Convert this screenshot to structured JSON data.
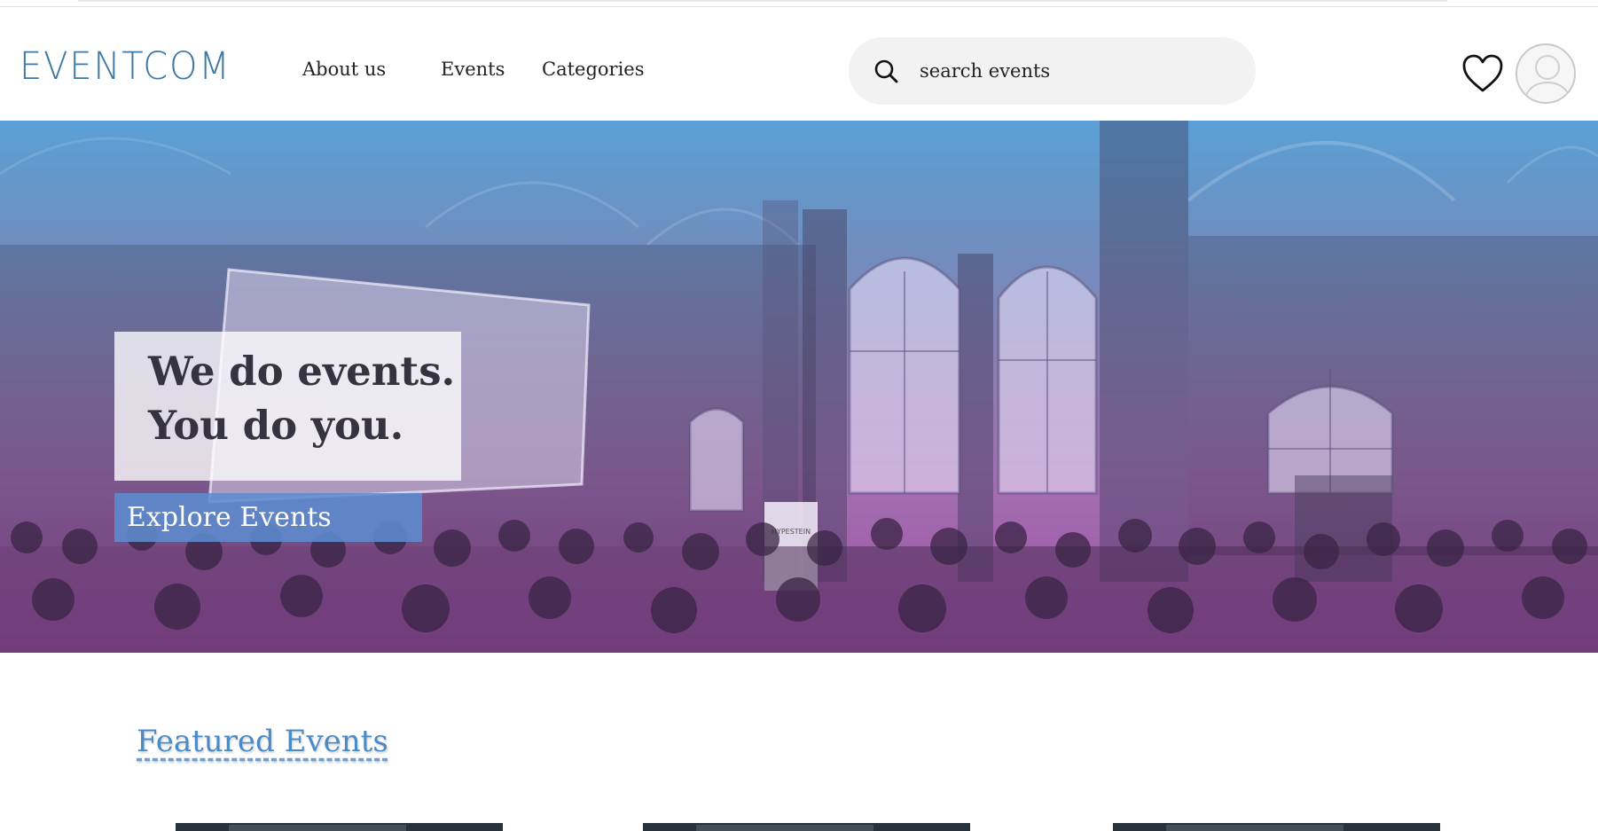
{
  "brand": {
    "logo": "EVENTCOM",
    "color": "#3d79a4"
  },
  "nav": {
    "items": [
      {
        "label": "About us"
      },
      {
        "label": "Events"
      },
      {
        "label": "Categories"
      }
    ]
  },
  "search": {
    "placeholder": "search events",
    "value": "",
    "icon": "search-icon"
  },
  "header_actions": {
    "favorites_icon": "heart-icon",
    "profile_icon": "user-avatar-icon"
  },
  "hero": {
    "headline_line1": "We do events.",
    "headline_line2": "You do you.",
    "cta_label": "Explore Events",
    "gradient_top": "#5aa0d6",
    "gradient_bottom": "#a34ea8",
    "banner_text": "HYPESTEIN"
  },
  "featured": {
    "title": "Featured Events",
    "color": "#4a8ac6"
  }
}
